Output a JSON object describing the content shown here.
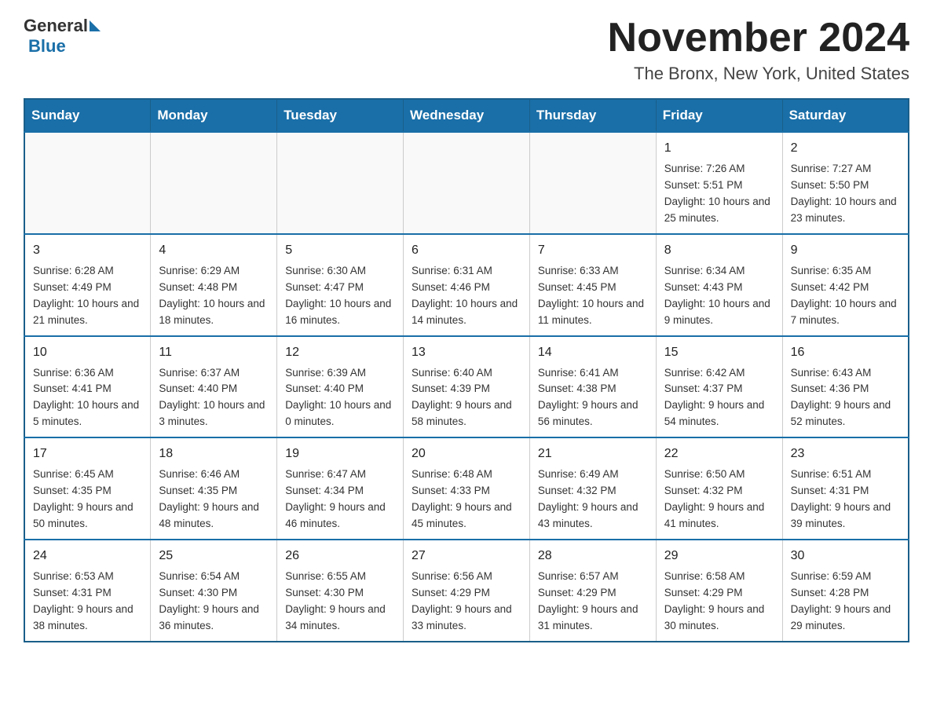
{
  "header": {
    "logo_general": "General",
    "logo_blue": "Blue",
    "month_title": "November 2024",
    "subtitle": "The Bronx, New York, United States"
  },
  "days_of_week": [
    "Sunday",
    "Monday",
    "Tuesday",
    "Wednesday",
    "Thursday",
    "Friday",
    "Saturday"
  ],
  "weeks": [
    [
      {
        "day": "",
        "info": ""
      },
      {
        "day": "",
        "info": ""
      },
      {
        "day": "",
        "info": ""
      },
      {
        "day": "",
        "info": ""
      },
      {
        "day": "",
        "info": ""
      },
      {
        "day": "1",
        "info": "Sunrise: 7:26 AM\nSunset: 5:51 PM\nDaylight: 10 hours and 25 minutes."
      },
      {
        "day": "2",
        "info": "Sunrise: 7:27 AM\nSunset: 5:50 PM\nDaylight: 10 hours and 23 minutes."
      }
    ],
    [
      {
        "day": "3",
        "info": "Sunrise: 6:28 AM\nSunset: 4:49 PM\nDaylight: 10 hours and 21 minutes."
      },
      {
        "day": "4",
        "info": "Sunrise: 6:29 AM\nSunset: 4:48 PM\nDaylight: 10 hours and 18 minutes."
      },
      {
        "day": "5",
        "info": "Sunrise: 6:30 AM\nSunset: 4:47 PM\nDaylight: 10 hours and 16 minutes."
      },
      {
        "day": "6",
        "info": "Sunrise: 6:31 AM\nSunset: 4:46 PM\nDaylight: 10 hours and 14 minutes."
      },
      {
        "day": "7",
        "info": "Sunrise: 6:33 AM\nSunset: 4:45 PM\nDaylight: 10 hours and 11 minutes."
      },
      {
        "day": "8",
        "info": "Sunrise: 6:34 AM\nSunset: 4:43 PM\nDaylight: 10 hours and 9 minutes."
      },
      {
        "day": "9",
        "info": "Sunrise: 6:35 AM\nSunset: 4:42 PM\nDaylight: 10 hours and 7 minutes."
      }
    ],
    [
      {
        "day": "10",
        "info": "Sunrise: 6:36 AM\nSunset: 4:41 PM\nDaylight: 10 hours and 5 minutes."
      },
      {
        "day": "11",
        "info": "Sunrise: 6:37 AM\nSunset: 4:40 PM\nDaylight: 10 hours and 3 minutes."
      },
      {
        "day": "12",
        "info": "Sunrise: 6:39 AM\nSunset: 4:40 PM\nDaylight: 10 hours and 0 minutes."
      },
      {
        "day": "13",
        "info": "Sunrise: 6:40 AM\nSunset: 4:39 PM\nDaylight: 9 hours and 58 minutes."
      },
      {
        "day": "14",
        "info": "Sunrise: 6:41 AM\nSunset: 4:38 PM\nDaylight: 9 hours and 56 minutes."
      },
      {
        "day": "15",
        "info": "Sunrise: 6:42 AM\nSunset: 4:37 PM\nDaylight: 9 hours and 54 minutes."
      },
      {
        "day": "16",
        "info": "Sunrise: 6:43 AM\nSunset: 4:36 PM\nDaylight: 9 hours and 52 minutes."
      }
    ],
    [
      {
        "day": "17",
        "info": "Sunrise: 6:45 AM\nSunset: 4:35 PM\nDaylight: 9 hours and 50 minutes."
      },
      {
        "day": "18",
        "info": "Sunrise: 6:46 AM\nSunset: 4:35 PM\nDaylight: 9 hours and 48 minutes."
      },
      {
        "day": "19",
        "info": "Sunrise: 6:47 AM\nSunset: 4:34 PM\nDaylight: 9 hours and 46 minutes."
      },
      {
        "day": "20",
        "info": "Sunrise: 6:48 AM\nSunset: 4:33 PM\nDaylight: 9 hours and 45 minutes."
      },
      {
        "day": "21",
        "info": "Sunrise: 6:49 AM\nSunset: 4:32 PM\nDaylight: 9 hours and 43 minutes."
      },
      {
        "day": "22",
        "info": "Sunrise: 6:50 AM\nSunset: 4:32 PM\nDaylight: 9 hours and 41 minutes."
      },
      {
        "day": "23",
        "info": "Sunrise: 6:51 AM\nSunset: 4:31 PM\nDaylight: 9 hours and 39 minutes."
      }
    ],
    [
      {
        "day": "24",
        "info": "Sunrise: 6:53 AM\nSunset: 4:31 PM\nDaylight: 9 hours and 38 minutes."
      },
      {
        "day": "25",
        "info": "Sunrise: 6:54 AM\nSunset: 4:30 PM\nDaylight: 9 hours and 36 minutes."
      },
      {
        "day": "26",
        "info": "Sunrise: 6:55 AM\nSunset: 4:30 PM\nDaylight: 9 hours and 34 minutes."
      },
      {
        "day": "27",
        "info": "Sunrise: 6:56 AM\nSunset: 4:29 PM\nDaylight: 9 hours and 33 minutes."
      },
      {
        "day": "28",
        "info": "Sunrise: 6:57 AM\nSunset: 4:29 PM\nDaylight: 9 hours and 31 minutes."
      },
      {
        "day": "29",
        "info": "Sunrise: 6:58 AM\nSunset: 4:29 PM\nDaylight: 9 hours and 30 minutes."
      },
      {
        "day": "30",
        "info": "Sunrise: 6:59 AM\nSunset: 4:28 PM\nDaylight: 9 hours and 29 minutes."
      }
    ]
  ]
}
